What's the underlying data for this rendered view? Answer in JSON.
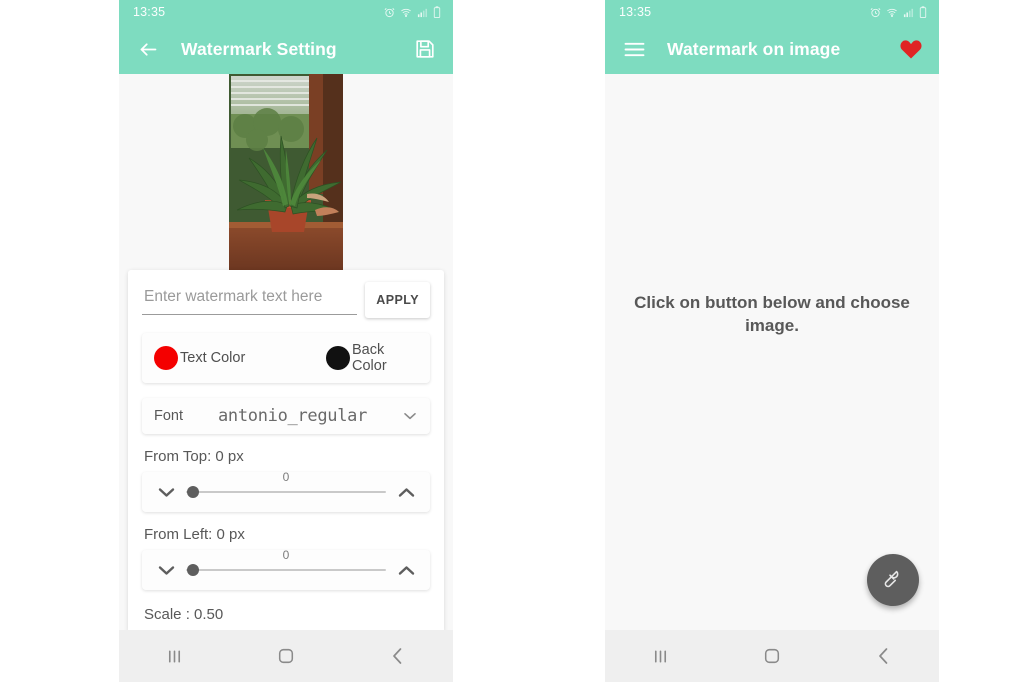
{
  "canvas": {
    "background": "#ffffff",
    "accent": "#7edcc0"
  },
  "phone_left": {
    "status_bar": {
      "time": "13:35",
      "icons": [
        "alarm-icon",
        "wifi-icon",
        "signal-icon",
        "battery-icon"
      ]
    },
    "app_bar": {
      "back_icon": "arrow-left-icon",
      "title": "Watermark Setting",
      "action_icon": "save-floppy-icon"
    },
    "preview": {
      "image_alt": "aloe plant on windowsill"
    },
    "form": {
      "watermark_input": {
        "value": "",
        "placeholder": "Enter watermark text here"
      },
      "apply_label": "APPLY",
      "text_color": {
        "label": "Text Color",
        "swatch": "#f40000"
      },
      "back_color": {
        "label": "Back Color",
        "swatch": "#111111"
      },
      "font": {
        "key": "Font",
        "value": "antonio_regular",
        "caret_icon": "chevron-down-icon"
      },
      "from_top": {
        "label": "From Top: 0 px",
        "value": "0",
        "min_icon": "chevron-down-icon",
        "max_icon": "chevron-up-icon"
      },
      "from_left": {
        "label": "From Left: 0 px",
        "value": "0",
        "min_icon": "chevron-down-icon",
        "max_icon": "chevron-up-icon"
      },
      "scale": {
        "label": "Scale : 0.50"
      }
    },
    "nav_bar": {
      "recents_icon": "recents-icon",
      "home_icon": "home-icon",
      "back_icon": "back-chevron-icon"
    }
  },
  "phone_right": {
    "status_bar": {
      "time": "13:35",
      "icons": [
        "alarm-icon",
        "wifi-icon",
        "signal-icon",
        "battery-icon"
      ]
    },
    "app_bar": {
      "menu_icon": "hamburger-menu-icon",
      "title": "Watermark on image",
      "action_icon": "heart-icon",
      "action_color": "#e02424"
    },
    "empty_state": {
      "message": "Click on button below and choose image."
    },
    "fab": {
      "icon": "stamp-icon",
      "color": "#5e5e5e"
    },
    "nav_bar": {
      "recents_icon": "recents-icon",
      "home_icon": "home-icon",
      "back_icon": "back-chevron-icon"
    }
  }
}
